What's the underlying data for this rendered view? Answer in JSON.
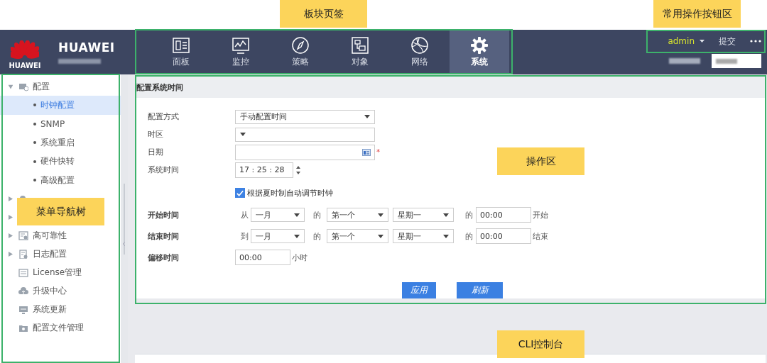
{
  "header": {
    "brand": "HUAWEI",
    "logo_caption": "HUAWEI",
    "tabs_callout": "板块页签",
    "tabs": [
      {
        "label": "面板",
        "selected": false
      },
      {
        "label": "监控",
        "selected": false
      },
      {
        "label": "策略",
        "selected": false
      },
      {
        "label": "对象",
        "selected": false
      },
      {
        "label": "网络",
        "selected": false
      },
      {
        "label": "系统",
        "selected": true
      }
    ],
    "actions_callout": "常用操作按钮区",
    "user": "admin",
    "submit": "提交"
  },
  "sidebar": {
    "callout": "菜单导航树",
    "items": [
      {
        "label": "配置",
        "kind": "group",
        "expanded": true,
        "children": [
          {
            "label": "时钟配置",
            "selected": true
          },
          {
            "label": "SNMP",
            "selected": false
          },
          {
            "label": "系统重启",
            "selected": false
          },
          {
            "label": "硬件快转",
            "selected": false
          },
          {
            "label": "高级配置",
            "selected": false
          }
        ]
      },
      {
        "kind": "group",
        "expanded": false
      },
      {
        "kind": "group",
        "expanded": false
      },
      {
        "label": "高可靠性",
        "kind": "group",
        "expanded": false
      },
      {
        "label": "日志配置",
        "kind": "group",
        "expanded": false
      },
      {
        "label": "License管理",
        "kind": "leaf"
      },
      {
        "label": "升级中心",
        "kind": "leaf"
      },
      {
        "label": "系统更新",
        "kind": "leaf"
      },
      {
        "label": "配置文件管理",
        "kind": "leaf"
      }
    ]
  },
  "operation_panel": {
    "callout": "操作区",
    "title": "配置系统时间",
    "fields": [
      {
        "kind": "select",
        "label": "配置方式",
        "value": "手动配置时间"
      },
      {
        "kind": "select",
        "label": "时区"
      },
      {
        "kind": "date",
        "label": "日期",
        "required_mark": "*"
      },
      {
        "kind": "time",
        "label": "系统时间",
        "value": "17 : 25 : 28"
      },
      {
        "kind": "checkbox",
        "label": "根据夏时制自动调节时钟",
        "checked": true
      },
      {
        "kind": "range",
        "label": "开始时间",
        "prefix": "从",
        "month": "一月",
        "of": "的",
        "week": "第一个",
        "day": "星期一",
        "of_time": "的",
        "time": "00:00",
        "suffix": "开始"
      },
      {
        "kind": "range",
        "label": "结束时间",
        "prefix": "到",
        "month": "一月",
        "of": "的",
        "week": "第一个",
        "day": "星期一",
        "of_time": "的",
        "time": "00:00",
        "suffix": "结束"
      },
      {
        "kind": "text",
        "label": "偏移时间",
        "value": "00:00",
        "unit": "小时"
      }
    ],
    "buttons": [
      "应用",
      "刷新"
    ]
  },
  "cli_console": {
    "callout": "CLI控制台"
  }
}
